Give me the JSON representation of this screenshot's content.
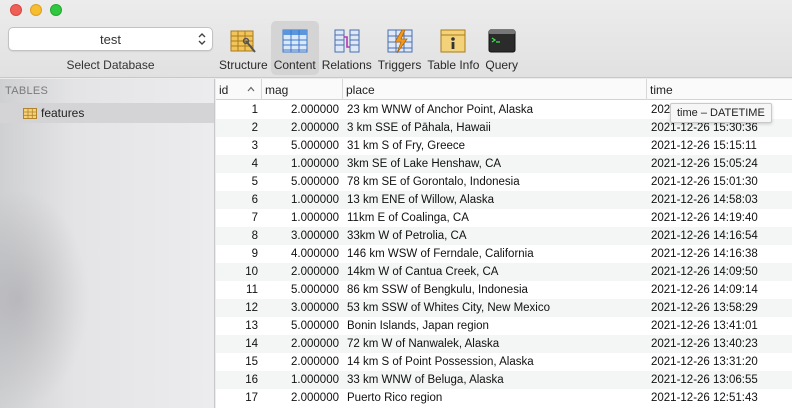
{
  "toolbar": {
    "database": {
      "selected": "test",
      "label": "Select Database"
    },
    "tools": [
      {
        "label": "Structure",
        "icon": "structure-icon"
      },
      {
        "label": "Content",
        "icon": "content-icon",
        "active": true
      },
      {
        "label": "Relations",
        "icon": "relations-icon"
      },
      {
        "label": "Triggers",
        "icon": "triggers-icon"
      },
      {
        "label": "Table Info",
        "icon": "table-info-icon"
      },
      {
        "label": "Query",
        "icon": "query-icon"
      }
    ]
  },
  "sidebar": {
    "heading": "TABLES",
    "tables": [
      {
        "name": "features",
        "selected": true
      }
    ]
  },
  "grid": {
    "columns": [
      "id",
      "mag",
      "place",
      "time"
    ],
    "sorted_column": "id",
    "rows": [
      {
        "id": "1",
        "mag": "2.000000",
        "place": "23 km WNW of Anchor Point, Alaska",
        "time": "202"
      },
      {
        "id": "2",
        "mag": "2.000000",
        "place": "3 km SSE of Pāhala, Hawaii",
        "time": "2021-12-26 15:30:36"
      },
      {
        "id": "3",
        "mag": "5.000000",
        "place": "31 km S of Fry, Greece",
        "time": "2021-12-26 15:15:11"
      },
      {
        "id": "4",
        "mag": "1.000000",
        "place": "3km SE of Lake Henshaw, CA",
        "time": "2021-12-26 15:05:24"
      },
      {
        "id": "5",
        "mag": "5.000000",
        "place": "78 km SE of Gorontalo, Indonesia",
        "time": "2021-12-26 15:01:30"
      },
      {
        "id": "6",
        "mag": "1.000000",
        "place": "13 km ENE of Willow, Alaska",
        "time": "2021-12-26 14:58:03"
      },
      {
        "id": "7",
        "mag": "1.000000",
        "place": "11km E of Coalinga, CA",
        "time": "2021-12-26 14:19:40"
      },
      {
        "id": "8",
        "mag": "3.000000",
        "place": "33km W of Petrolia, CA",
        "time": "2021-12-26 14:16:54"
      },
      {
        "id": "9",
        "mag": "4.000000",
        "place": "146 km WSW of Ferndale, California",
        "time": "2021-12-26 14:16:38"
      },
      {
        "id": "10",
        "mag": "2.000000",
        "place": "14km W of Cantua Creek, CA",
        "time": "2021-12-26 14:09:50"
      },
      {
        "id": "11",
        "mag": "5.000000",
        "place": "86 km SSW of Bengkulu, Indonesia",
        "time": "2021-12-26 14:09:14"
      },
      {
        "id": "12",
        "mag": "3.000000",
        "place": "53 km SSW of Whites City, New Mexico",
        "time": "2021-12-26 13:58:29"
      },
      {
        "id": "13",
        "mag": "5.000000",
        "place": "Bonin Islands, Japan region",
        "time": "2021-12-26 13:41:01"
      },
      {
        "id": "14",
        "mag": "2.000000",
        "place": "72 km W of Nanwalek, Alaska",
        "time": "2021-12-26 13:40:23"
      },
      {
        "id": "15",
        "mag": "2.000000",
        "place": "14 km S of Point Possession, Alaska",
        "time": "2021-12-26 13:31:20"
      },
      {
        "id": "16",
        "mag": "1.000000",
        "place": "33 km WNW of Beluga, Alaska",
        "time": "2021-12-26 13:06:55"
      },
      {
        "id": "17",
        "mag": "2.000000",
        "place": "Puerto Rico region",
        "time": "2021-12-26 12:51:43"
      }
    ],
    "tooltip": "time – DATETIME"
  },
  "colors": {
    "close": "#ee5f57",
    "minimize": "#f5bd2f",
    "maximize": "#2fc840",
    "active_tool_bg": "#d4d4d4",
    "row_stripe": "#f4f5f5"
  }
}
